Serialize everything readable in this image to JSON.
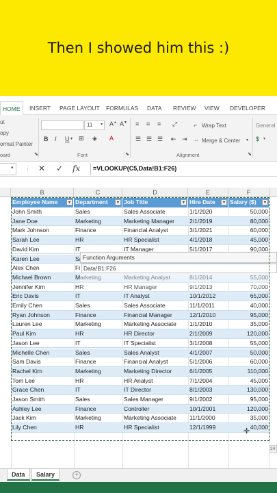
{
  "caption": {
    "text": "Then I showed him this :)"
  },
  "ribbon_tabs": [
    "HOME",
    "INSERT",
    "PAGE LAYOUT",
    "FORMULAS",
    "DATA",
    "REVIEW",
    "VIEW",
    "DEVELOPER"
  ],
  "ribbon": {
    "cut": "ut",
    "copy": "opy",
    "format_painter": "ormat Painter",
    "clipboard_group": "oard",
    "font_size": "11",
    "bold": "B",
    "italic": "I",
    "underline": "U",
    "font_group": "Font",
    "wrap_text": "Wrap Text",
    "merge_center": "Merge & Center",
    "alignment_group": "Alignment",
    "number_format": "General"
  },
  "formula_bar": {
    "cancel": "✕",
    "enter": "✓",
    "fx": "fx",
    "formula": "=VLOOKUP(C5,Data!B1:F26)"
  },
  "columns": [
    "B",
    "C",
    "D",
    "E",
    "F"
  ],
  "table": {
    "headers": [
      "Employee Name",
      "Department",
      "Job Title",
      "Hire Date",
      "Salary ($)"
    ],
    "rows": [
      [
        "John Smith",
        "Sales",
        "Sales Associate",
        "1/1/2020",
        "50,000"
      ],
      [
        "Jane Doe",
        "Marketing",
        "Marketing Manager",
        "2/1/2019",
        "80,000"
      ],
      [
        "Mark Johnson",
        "Finance",
        "Financial Analyst",
        "3/1/2021",
        "60,000"
      ],
      [
        "Sarah Lee",
        "HR",
        "HR Specialist",
        "4/1/2018",
        "45,000"
      ],
      [
        "David Kim",
        "IT",
        "IT Manager",
        "5/1/2017",
        "90,000"
      ],
      [
        "Karen Lee",
        "Sa",
        "",
        "",
        ""
      ],
      [
        "Alex Chen",
        "Fi",
        "",
        "",
        ""
      ],
      [
        "Michael Brown",
        "Marketing",
        "Marketing Analyst",
        "8/1/2014",
        "55,000"
      ],
      [
        "Jennifer Kim",
        "HR",
        "HR Manager",
        "9/1/2013",
        "70,000"
      ],
      [
        "Eric Davis",
        "IT",
        "IT Analyst",
        "10/1/2012",
        "65,000"
      ],
      [
        "Emily Chen",
        "Sales",
        "Sales Associate",
        "11/1/2011",
        "40,000"
      ],
      [
        "Ryan Johnson",
        "Finance",
        "Financial Manager",
        "12/1/2010",
        "95,000"
      ],
      [
        "Lauren Lee",
        "Marketing",
        "Marketing Associate",
        "1/1/2010",
        "35,000"
      ],
      [
        "Paul Kim",
        "HR",
        "HR Director",
        "2/1/2009",
        "120,000"
      ],
      [
        "Jason Lee",
        "IT",
        "IT Specialist",
        "3/1/2008",
        "55,000"
      ],
      [
        "Michelle Chen",
        "Sales",
        "Sales Analyst",
        "4/1/2007",
        "50,000"
      ],
      [
        "Sam Davis",
        "Finance",
        "Financial Analyst",
        "5/1/2006",
        "60,000"
      ],
      [
        "Rachel Kim",
        "Marketing",
        "Marketing Director",
        "6/1/2005",
        "110,000"
      ],
      [
        "Tom Lee",
        "HR",
        "HR Analyst",
        "7/1/2004",
        "45,000"
      ],
      [
        "Grace Chen",
        "IT",
        "IT Director",
        "8/1/2003",
        "130,000"
      ],
      [
        "Jason Smith",
        "Sales",
        "Sales Manager",
        "9/1/2002",
        "95,000"
      ],
      [
        "Ashley Lee",
        "Finance",
        "Controller",
        "10/1/2001",
        "120,000"
      ],
      [
        "Jack Kim",
        "Marketing",
        "Marketing Associate",
        "11/1/2000",
        "35,000"
      ],
      [
        "Lily Chen",
        "HR",
        "HR Specialist",
        "12/1/1999",
        "40,000"
      ]
    ]
  },
  "tooltip": {
    "title": "Function Arguments",
    "argument": "Data!B1:F26"
  },
  "mini_tag": "24",
  "sheet_tabs": [
    "Data",
    "Salary"
  ],
  "add_sheet": "+",
  "colors": {
    "caption_bg": "#fde800",
    "excel_green": "#217346",
    "table_header": "#5b9bd5",
    "table_band": "#ddebf7"
  }
}
